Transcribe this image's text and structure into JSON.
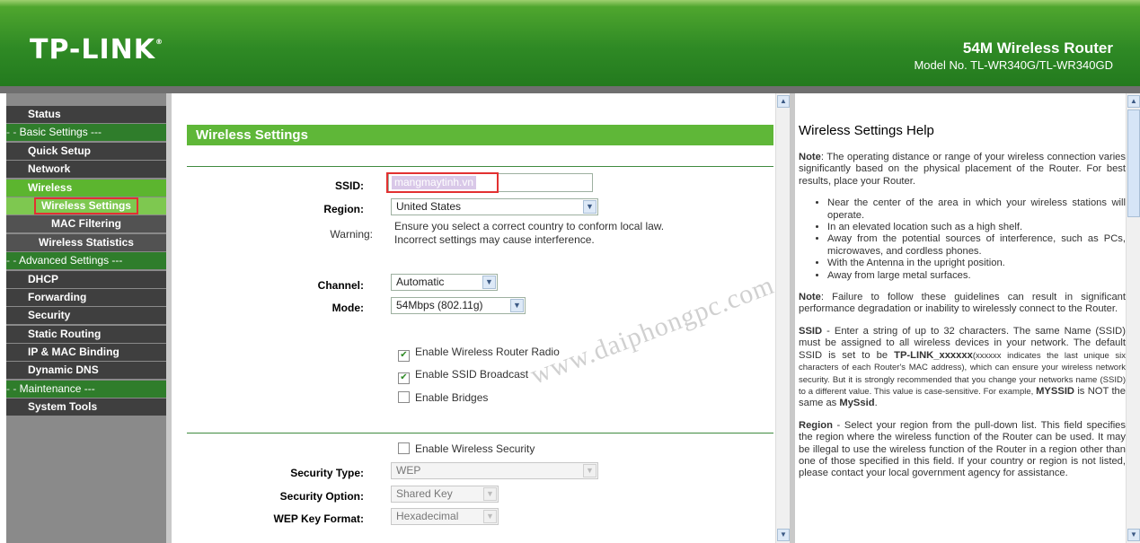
{
  "header": {
    "logo": "TP-LINK",
    "logo_mark": "®",
    "product": "54M Wireless Router",
    "model": "Model No. TL-WR340G/TL-WR340GD"
  },
  "sidebar": {
    "items": [
      {
        "label": "Status"
      },
      {
        "label": "Basic Settings ---"
      },
      {
        "label": "Quick Setup"
      },
      {
        "label": "Network"
      },
      {
        "label": "Wireless"
      },
      {
        "label": "Wireless Settings"
      },
      {
        "label": "MAC Filtering"
      },
      {
        "label": "Wireless Statistics"
      },
      {
        "label": "Advanced Settings ---"
      },
      {
        "label": "DHCP"
      },
      {
        "label": "Forwarding"
      },
      {
        "label": "Security"
      },
      {
        "label": "Static Routing"
      },
      {
        "label": "IP & MAC Binding"
      },
      {
        "label": "Dynamic DNS"
      },
      {
        "label": "Maintenance ---"
      },
      {
        "label": "System Tools"
      }
    ]
  },
  "main": {
    "title": "Wireless Settings",
    "ssid_label": "SSID:",
    "ssid_value": "mangmaytinh.vn",
    "region_label": "Region:",
    "region_value": "United States",
    "warning_label": "Warning:",
    "warning_line1": "Ensure you select a correct country to conform local law.",
    "warning_line2": "Incorrect settings may cause interference.",
    "channel_label": "Channel:",
    "channel_value": "Automatic",
    "mode_label": "Mode:",
    "mode_value": "54Mbps (802.11g)",
    "enable_radio": "Enable Wireless Router Radio",
    "enable_broadcast": "Enable SSID Broadcast",
    "enable_bridges": "Enable Bridges",
    "enable_security": "Enable Wireless Security",
    "security_type_label": "Security Type:",
    "security_type_value": "WEP",
    "security_option_label": "Security Option:",
    "security_option_value": "Shared Key",
    "wep_key_format_label": "WEP Key Format:",
    "wep_key_format_value": "Hexadecimal",
    "watermark": "www.daiphongpc.com"
  },
  "checkboxes": {
    "radio": true,
    "broadcast": true,
    "bridges": false,
    "security": false
  },
  "help": {
    "title": "Wireless Settings Help",
    "note1_label": "Note",
    "note1_text": ": The operating distance or range of your wireless connection varies significantly based on the physical placement of the Router. For best results, place your Router.",
    "bullets": [
      "Near the center of the area in which your wireless stations will operate.",
      "In an elevated location such as a high shelf.",
      "Away from the potential sources of interference, such as PCs, microwaves, and cordless phones.",
      "With the Antenna in the upright position.",
      "Away from large metal surfaces."
    ],
    "note2_label": "Note",
    "note2_text": ": Failure to follow these guidelines can result in significant performance degradation or inability to wirelessly connect to the Router.",
    "ssid_label": "SSID",
    "ssid_text1": " - Enter a string of up to 32 characters. The same Name (SSID) must be assigned to all wireless devices in your network. The default SSID is set to be ",
    "ssid_default": "TP-LINK_xxxxxx",
    "ssid_text2": "(xxxxxx indicates the last unique six characters of each Router's MAC address), which can ensure your wireless network security. But it is strongly recommended that you change your networks name (SSID) to a different value. This value is case-sensitive. For example, ",
    "ssid_ex1": "MYSSID",
    "ssid_text3": " is NOT the same as ",
    "ssid_ex2": "MySsid",
    "ssid_text4": ".",
    "region_label": "Region",
    "region_text": " - Select your region from the pull-down list. This field specifies the region where the wireless function of the Router can be used. It may be illegal to use the wireless function of the Router in a region other than one of those specified in this field. If your country or region is not listed, please contact your local government agency for assistance."
  }
}
